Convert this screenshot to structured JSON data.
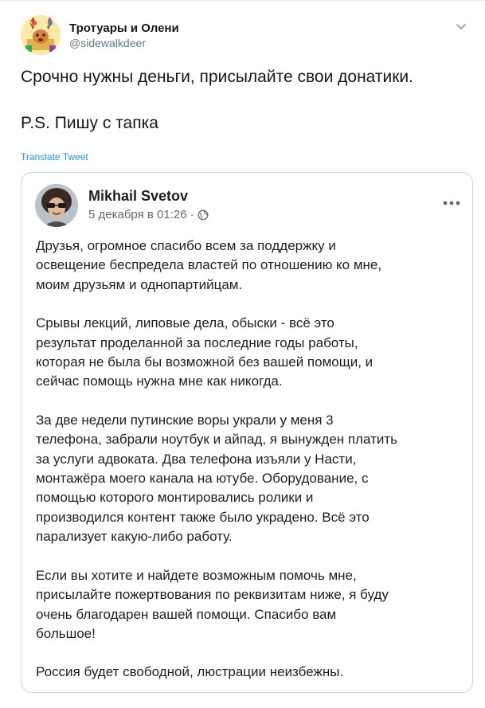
{
  "tweet": {
    "author_name": "Тротуары и Олени",
    "author_handle": "@sidewalkdeer",
    "text_line1": "Срочно нужны деньги, присылайте свои донатики.",
    "text_line2": "P.S. Пишу с тапка",
    "translate_label": "Translate Tweet",
    "menu_icon": "chevron-down-icon",
    "avatar_icon": "cartoon-deer-avatar"
  },
  "facebook_post": {
    "author_name": "Mikhail Svetov",
    "date": "5 декабря в 01:26",
    "separator": "·",
    "privacy_icon": "globe-icon",
    "more_icon": "more-dots-icon",
    "paragraphs": [
      {
        "lines": [
          "Друзья, огромное спасибо всем за поддержку и",
          "освещение беспредела властей по отношению ко мне,",
          "моим друзьям и однопартийцам."
        ]
      },
      {
        "lines": [
          "Срывы лекций, липовые дела, обыски - всё это",
          "результат проделанной за последние годы работы,",
          "которая не была бы возможной без вашей помощи, и",
          "сейчас помощь нужна мне как никогда."
        ]
      },
      {
        "lines": [
          "За две недели путинские воры украли у меня 3",
          "телефона, забрали ноутбук и айпад, я вынужден платить",
          "за услуги адвоката. Два телефона изъяли у Насти,",
          "монтажёра моего канала на ютубе. Оборудование, с",
          "помощью которого монтировались ролики и",
          "производился контент также было украдено. Всё это",
          "парализует какую-либо работу."
        ]
      },
      {
        "lines": [
          "Если вы хотите и найдете возможным помочь мне,",
          "присылайте пожертвования по реквизитам ниже, я буду",
          "очень благодарен вашей помощи. Спасибо вам",
          "большое!"
        ]
      },
      {
        "lines": [
          "Россия будет свободной, люстрации неизбежны."
        ]
      }
    ]
  },
  "colors": {
    "link": "#1b95e0",
    "secondary_text": "#657786",
    "fb_meta": "#65676b",
    "border": "#ccd6dd"
  }
}
